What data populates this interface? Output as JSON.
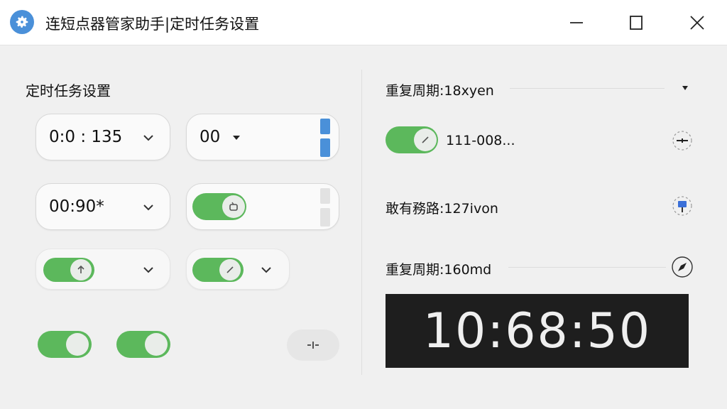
{
  "window": {
    "title": "连短点器管家助手|定时任务设置",
    "icon": "gear-icon",
    "controls": [
      "minimize-icon",
      "maximize-icon",
      "close-icon"
    ]
  },
  "left_panel": {
    "section_title": "定时任务设置",
    "time_fields": [
      {
        "value": "0:0 : 135"
      },
      {
        "value": "00"
      },
      {
        "value": "00:90*"
      }
    ],
    "toggles": [
      {
        "state": "on",
        "icon": "arrow-up-icon"
      },
      {
        "state": "on",
        "icon": "slash-icon"
      },
      {
        "state": "on",
        "icon": "copy-icon"
      },
      {
        "state": "on"
      },
      {
        "state": "on"
      }
    ],
    "slim_button_icon": "split-icon"
  },
  "right_panel": {
    "rows": [
      {
        "label": "重复周期:18xyen",
        "control": "dropdown-caret-icon"
      },
      {
        "label": "111-008...",
        "toggle_state": "on",
        "icon": "crosshair-icon"
      },
      {
        "label": "敢有務路:127ivon",
        "icon": "pin-icon"
      },
      {
        "label": "重复周期:160md",
        "icon": "compass-icon"
      }
    ],
    "clock": {
      "time": "10:68:50"
    }
  },
  "colors": {
    "toggle_on": "#5cb85c",
    "accent_blue": "#4a90d9",
    "clock_bg": "#1e1e1e"
  }
}
